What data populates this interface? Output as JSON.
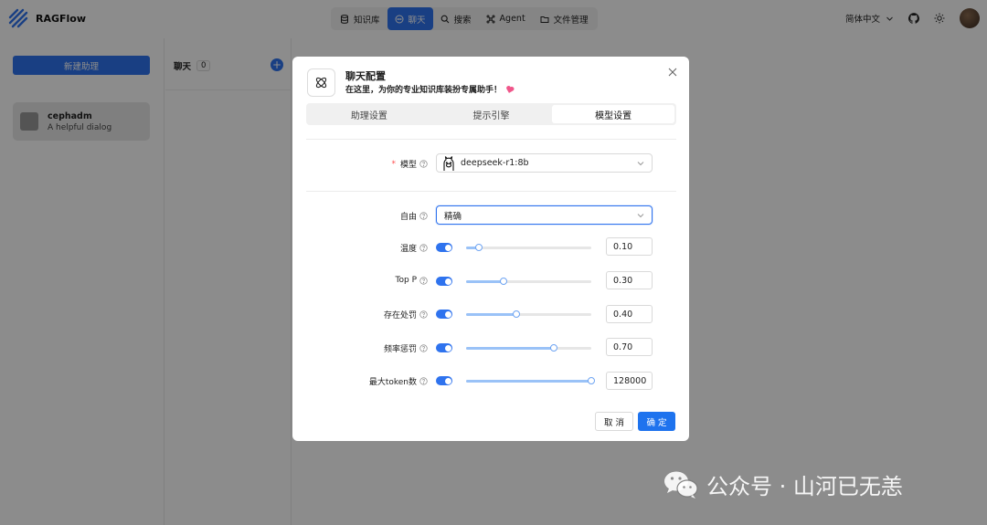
{
  "app": {
    "name": "RAGFlow"
  },
  "nav": {
    "items": [
      {
        "label": "知识库",
        "icon": "database-icon"
      },
      {
        "label": "聊天",
        "icon": "chat-icon",
        "active": true
      },
      {
        "label": "搜索",
        "icon": "search-icon"
      },
      {
        "label": "Agent",
        "icon": "agent-icon"
      },
      {
        "label": "文件管理",
        "icon": "folder-icon"
      }
    ]
  },
  "header": {
    "language": "简体中文"
  },
  "sidebar": {
    "new_assistant": "新建助理",
    "assistant": {
      "name": "cephadm",
      "description": "A helpful dialog"
    }
  },
  "chat_panel": {
    "title": "聊天",
    "count": "0"
  },
  "modal": {
    "title": "聊天配置",
    "subtitle": "在这里，为你的专业知识库装扮专属助手！",
    "tabs": [
      "助理设置",
      "提示引擎",
      "模型设置"
    ],
    "active_tab": 2,
    "model": {
      "label": "模型",
      "value": "deepseek-r1:8b"
    },
    "freedom": {
      "label": "自由",
      "value": "精确"
    },
    "params": [
      {
        "label": "温度",
        "value": "0.10",
        "fraction": 0.1
      },
      {
        "label": "Top P",
        "value": "0.30",
        "fraction": 0.3
      },
      {
        "label": "存在处罚",
        "value": "0.40",
        "fraction": 0.4
      },
      {
        "label": "频率惩罚",
        "value": "0.70",
        "fraction": 0.7
      },
      {
        "label": "最大token数",
        "value": "128000",
        "fraction": 1.0
      }
    ],
    "cancel": "取 消",
    "ok": "确 定"
  },
  "watermark": {
    "text": "公众号 · 山河已无恙"
  },
  "colors": {
    "primary": "#2f73ee",
    "slider_track": "#9ac2f7",
    "required": "#ff4d4f"
  }
}
